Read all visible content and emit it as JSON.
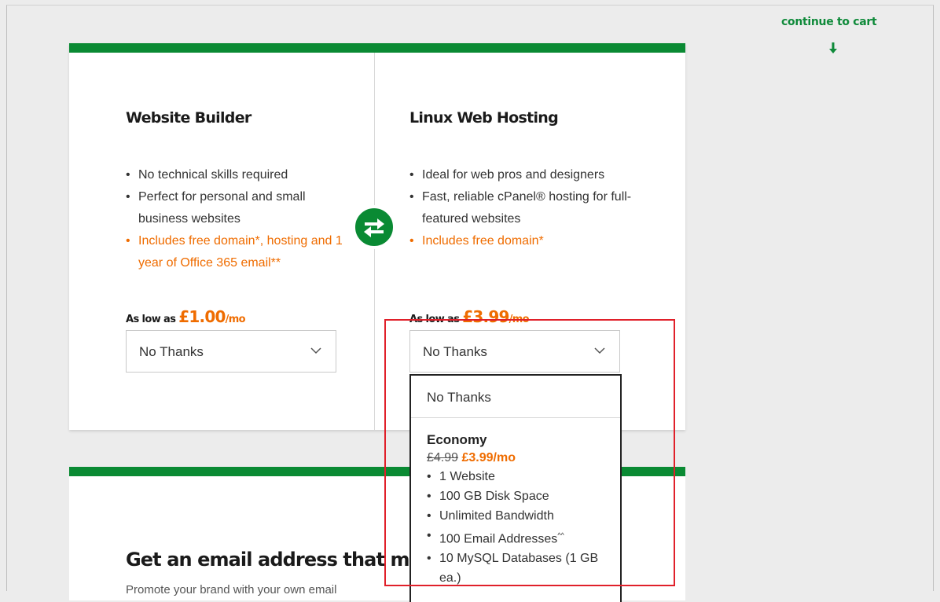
{
  "header": {
    "continue_label": "continue to cart"
  },
  "products": [
    {
      "title": "Website Builder",
      "features": [
        "No technical skills required",
        "Perfect for personal and small business websites",
        "Includes free domain*, hosting and 1 year of Office 365 email**"
      ],
      "price_prefix": "As low as ",
      "price": "£1.00",
      "price_unit": "/mo",
      "select_value": "No Thanks"
    },
    {
      "title": "Linux Web Hosting",
      "features": [
        "Ideal for web pros and designers",
        "Fast, reliable cPanel® hosting for full-featured websites",
        "Includes free domain*"
      ],
      "price_prefix": "As low as ",
      "price": "£3.99",
      "price_unit": "/mo",
      "select_value": "No Thanks"
    }
  ],
  "dropdown": {
    "option_none": "No Thanks",
    "economy": {
      "name": "Economy",
      "old_price": "£4.99",
      "new_price": "£3.99/mo",
      "features": [
        "1 Website",
        "100 GB Disk Space",
        "Unlimited Bandwidth",
        "100 Email Addresses",
        "10 MySQL Databases (1 GB ea.)"
      ],
      "email_sup": "^^"
    }
  },
  "email_section": {
    "heading": "Get an email address that mat",
    "subtext": "Promote your brand with your own email"
  },
  "colors": {
    "brand_green": "#0a8a33",
    "accent_orange": "#ef6c00",
    "highlight_red": "#e0202a"
  }
}
